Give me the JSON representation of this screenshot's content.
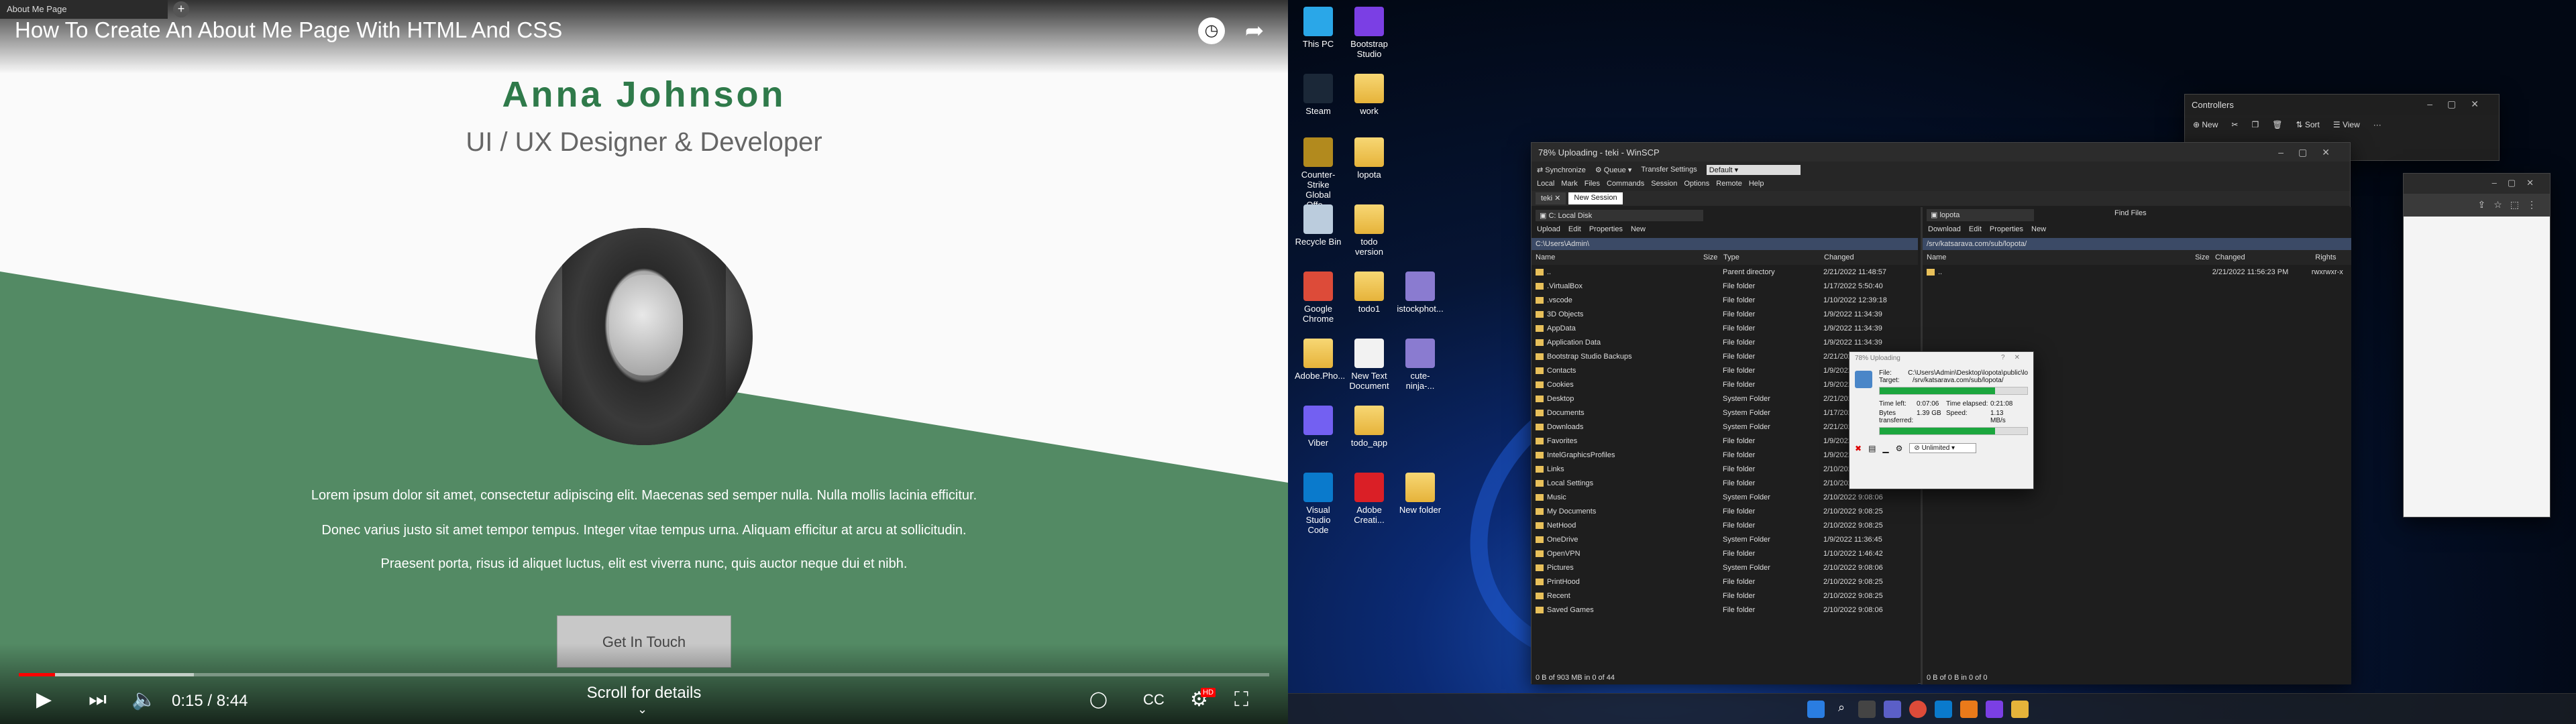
{
  "video": {
    "browser_tab": "About Me Page",
    "title": "How To Create An About Me Page With HTML And CSS",
    "name": "Anna Johnson",
    "role": "UI / UX Designer & Developer",
    "paragraphs": [
      "Lorem ipsum dolor sit amet, consectetur adipiscing elit. Maecenas sed semper nulla. Nulla mollis lacinia efficitur.",
      "Donec varius justo sit amet tempor tempus. Integer vitae tempus urna. Aliquam efficitur at arcu at sollicitudin.",
      "Praesent porta, risus id aliquet luctus, elit est viverra nunc, quis auctor neque dui et nibh."
    ],
    "cta": "Get In Touch",
    "scroll": "Scroll for details",
    "time": "0:15 / 8:44",
    "progress": 0.029,
    "buffered": 0.14,
    "hd_badge": "HD"
  },
  "desktop": {
    "icons": [
      {
        "label": "This PC",
        "kind": "pc"
      },
      {
        "label": "Bootstrap Studio",
        "kind": "app",
        "color": "#7b3fe4"
      },
      {
        "label": "Steam",
        "kind": "app",
        "color": "#1b2838"
      },
      {
        "label": "work",
        "kind": "folder"
      },
      {
        "label": "Counter-Strike Global Offe...",
        "kind": "app",
        "color": "#b28a1e"
      },
      {
        "label": "lopota",
        "kind": "folder"
      },
      {
        "label": "Recycle Bin",
        "kind": "bin"
      },
      {
        "label": "todo version",
        "kind": "folder"
      },
      {
        "label": "Google Chrome",
        "kind": "app",
        "color": "#dd4b39"
      },
      {
        "label": "todo1",
        "kind": "folder"
      },
      {
        "label": "istockphot...",
        "kind": "img"
      },
      {
        "label": "Adobe.Pho...",
        "kind": "folder"
      },
      {
        "label": "New Text Document",
        "kind": "doc"
      },
      {
        "label": "cute-ninja-...",
        "kind": "img"
      },
      {
        "label": "Viber",
        "kind": "app",
        "color": "#7360f2"
      },
      {
        "label": "todo_app",
        "kind": "folder"
      },
      {
        "label": "Visual Studio Code",
        "kind": "app",
        "color": "#0a7acc"
      },
      {
        "label": "Adobe Creati...",
        "kind": "app",
        "color": "#da1f26"
      },
      {
        "label": "New folder",
        "kind": "folder"
      }
    ],
    "explorer": {
      "title": "Controllers",
      "new": "New",
      "sort": "Sort",
      "view": "View"
    },
    "winscp": {
      "title": "78% Uploading - teki - WinSCP",
      "menu": [
        "Local",
        "Mark",
        "Files",
        "Commands",
        "Session",
        "Options",
        "Remote",
        "Help"
      ],
      "toolbar": {
        "sync": "Synchronize",
        "queue": "Queue",
        "transfer_settings": "Transfer Settings",
        "preset": "Default"
      },
      "tabs": [
        "teki",
        "New Session"
      ],
      "local": {
        "drive": "C: Local Disk",
        "path": "C:\\Users\\Admin\\",
        "actions": [
          "Upload",
          "Edit",
          "Properties",
          "New"
        ],
        "columns": [
          "Name",
          "Size",
          "Type",
          "Changed"
        ],
        "rows": [
          [
            "..",
            "",
            "Parent directory",
            "2/21/2022  11:48:57"
          ],
          [
            ".VirtualBox",
            "",
            "File folder",
            "1/17/2022  5:50:40"
          ],
          [
            ".vscode",
            "",
            "File folder",
            "1/10/2022  12:39:18"
          ],
          [
            "3D Objects",
            "",
            "File folder",
            "1/9/2022  11:34:39"
          ],
          [
            "AppData",
            "",
            "File folder",
            "1/9/2022  11:34:39"
          ],
          [
            "Application Data",
            "",
            "File folder",
            "1/9/2022  11:34:39"
          ],
          [
            "Bootstrap Studio Backups",
            "",
            "File folder",
            "2/21/2022  9:58:43"
          ],
          [
            "Contacts",
            "",
            "File folder",
            "1/9/2022  11:35:03"
          ],
          [
            "Cookies",
            "",
            "File folder",
            "1/9/2022  11:34:39"
          ],
          [
            "Desktop",
            "",
            "System Folder",
            "2/21/2022  9:53:41"
          ],
          [
            "Documents",
            "",
            "System Folder",
            "1/17/2022  5:50:33"
          ],
          [
            "Downloads",
            "",
            "System Folder",
            "2/21/2022  8:37:21"
          ],
          [
            "Favorites",
            "",
            "File folder",
            "1/9/2022  11:35:03"
          ],
          [
            "IntelGraphicsProfiles",
            "",
            "File folder",
            "1/9/2022  11:34:39"
          ],
          [
            "Links",
            "",
            "File folder",
            "2/10/2022  9:08:06"
          ],
          [
            "Local Settings",
            "",
            "File folder",
            "2/10/2022  9:08:25"
          ],
          [
            "Music",
            "",
            "System Folder",
            "2/10/2022  9:08:06"
          ],
          [
            "My Documents",
            "",
            "File folder",
            "2/10/2022  9:08:25"
          ],
          [
            "NetHood",
            "",
            "File folder",
            "2/10/2022  9:08:25"
          ],
          [
            "OneDrive",
            "",
            "System Folder",
            "1/9/2022  11:36:45"
          ],
          [
            "OpenVPN",
            "",
            "File folder",
            "1/10/2022  1:46:42"
          ],
          [
            "Pictures",
            "",
            "System Folder",
            "2/10/2022  9:08:06"
          ],
          [
            "PrintHood",
            "",
            "File folder",
            "2/10/2022  9:08:25"
          ],
          [
            "Recent",
            "",
            "File folder",
            "2/10/2022  9:08:25"
          ],
          [
            "Saved Games",
            "",
            "File folder",
            "2/10/2022  9:08:06"
          ]
        ],
        "status": "0 B of 903 MB in 0 of 44"
      },
      "remote": {
        "path_combo": "lopota",
        "find": "Find Files",
        "path": "/srv/katsarava.com/sub/lopota/",
        "actions": [
          "Download",
          "Edit",
          "Properties",
          "New"
        ],
        "columns": [
          "Name",
          "Size",
          "Changed",
          "Rights"
        ],
        "rows": [
          [
            "..",
            "",
            "2/21/2022  11:56:23 PM",
            "rwxrwxr-x"
          ]
        ],
        "status": "0 B of 0 B in 0 of 0"
      },
      "dialog": {
        "title": "78% Uploading",
        "file_label": "File:",
        "file": "C:\\Users\\Admin\\Desktop\\lopota\\public\\lopota.zip",
        "target_label": "Target:",
        "target": "/srv/katsarava.com/sub/lopota/",
        "time_left_label": "Time left:",
        "time_left": "0:07:06",
        "elapsed_label": "Time elapsed:",
        "elapsed": "0:21:08",
        "bytes_label": "Bytes transferred:",
        "bytes": "1.39 GB",
        "speed_label": "Speed:",
        "speed": "1.13 MB/s",
        "progress": 0.78,
        "limit": "Unlimited"
      }
    }
  }
}
